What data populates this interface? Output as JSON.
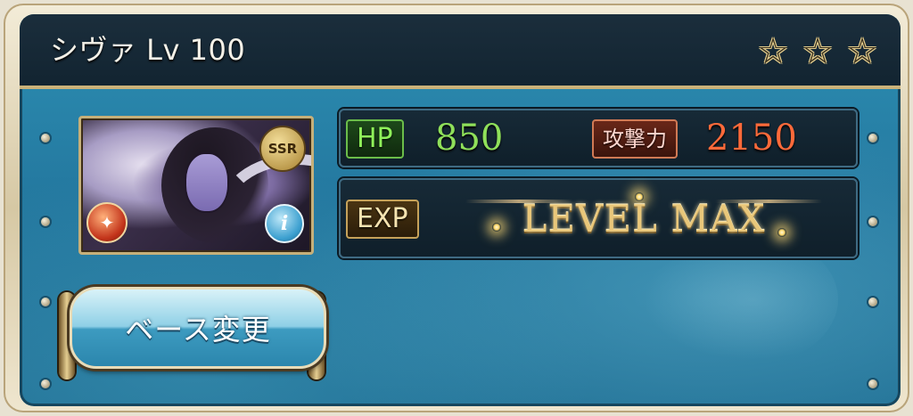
{
  "header": {
    "title": "シヴァ Lv 100",
    "stars": [
      "☆",
      "☆",
      "☆"
    ]
  },
  "character": {
    "rarity_badge": "SSR",
    "element_icon": "fire-element-icon",
    "info_icon": "i"
  },
  "stats": {
    "hp_label": "HP",
    "hp_value": "850",
    "atk_label": "攻撃力",
    "atk_value": "2150"
  },
  "exp": {
    "label": "EXP",
    "status": "LEVEL MAX"
  },
  "actions": {
    "base_change_label": "ベース変更"
  },
  "colors": {
    "panel_blue": "#2479a0",
    "header_dark": "#122431",
    "gold_trim": "#c9b27a",
    "hp_green": "#8fe05a",
    "atk_red": "#ff6a3a"
  }
}
